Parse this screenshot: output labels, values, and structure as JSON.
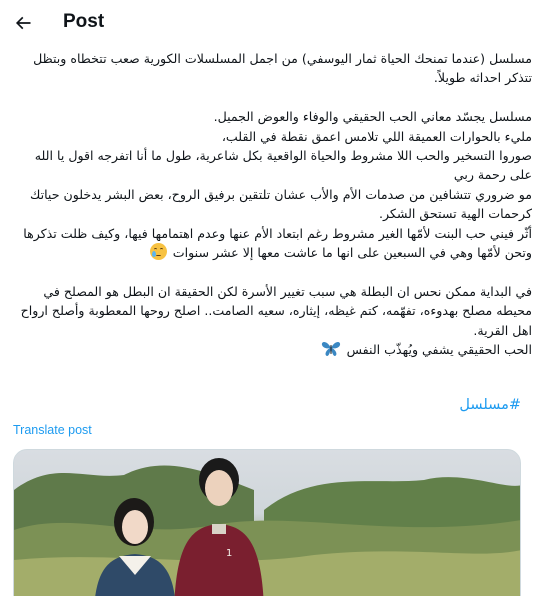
{
  "header": {
    "back_icon": "arrow-left-icon",
    "title": "Post"
  },
  "post": {
    "paragraphs": [
      [
        "مسلسل (عندما تمنحك الحياة ثمار اليوسفي) من اجمل المسلسلات الكورية صعب تتخطاه وبتظل تتذكر احداثه طويلاً."
      ],
      [
        "مسلسل يجسّد معاني الحب الحقيقي والوفاء والعوض الجميل.",
        "مليء بالحوارات العميقة اللي تلامس اعمق نقطة في القلب،",
        "صوروا التسخير  والحب اللا مشروط والحياة الواقعية بكل شاعرية، طول ما أنا اتفرجه اقول يا الله على رحمة ربي",
        "مو ضروري تتشافين من صدمات الأم والأب عشان تلتقين برفيق الروح، بعض البشر يدخلون حياتك كرحمات الهية تستحق الشكر.",
        "أثّر فيني حب البنت لأمّها الغير مشروط رغم ابتعاد الأم عنها وعدم اهتمامها فيها، وكيف ظلت تذكرها وتحن لأمّها وهي في السبعين على انها ما عاشت معها إلا عشر سنوات"
      ],
      [
        "في البداية ممكن نحس ان البطلة هي سبب تغيير الأسرة لكن الحقيقة ان البطل هو المصلح في محيطه مصلح بهدوءه، تفهّمه، كتم غيظه، إيثاره، سعيه الصامت.. اصلح روحها المعطوبة وأصلح ارواح اهل القرية.",
        "الحب الحقيقي يشفي ويُهذّب النفس"
      ]
    ],
    "emoji_tear": "face-holding-back-tears-icon",
    "emoji_butterfly": "butterfly-icon",
    "hashtag": "#مسلسل",
    "translate_label": "Translate post"
  },
  "media": {
    "alt": "drama-poster-image",
    "jacket_text": "1"
  }
}
